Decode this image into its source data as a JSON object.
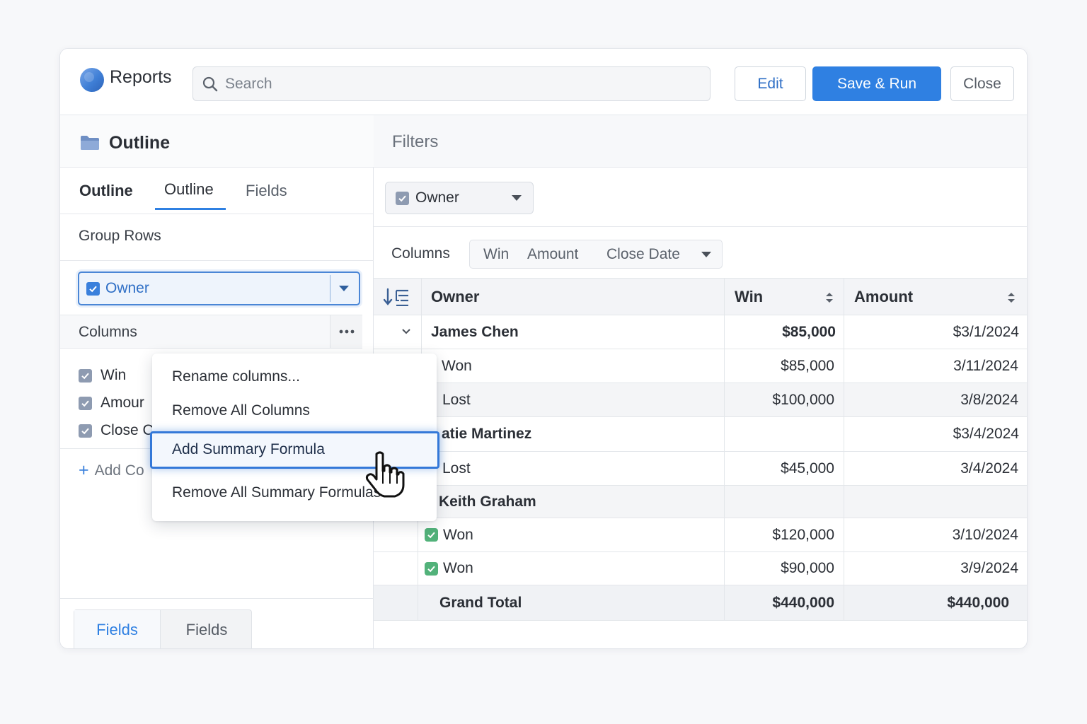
{
  "header": {
    "app_title": "Reports",
    "search_placeholder": "Search",
    "edit_label": "Edit",
    "save_run_label": "Save & Run",
    "close_label": "Close",
    "accent_color": "#2f80e2"
  },
  "left_panel": {
    "title": "Outline",
    "tabs": [
      "Outline",
      "Outline",
      "Fields"
    ],
    "active_tab": 1,
    "group_rows_label": "Group Rows",
    "group_select_value": "Owner",
    "columns_label": "Columns",
    "columns": [
      "Win",
      "Amour",
      "Close C"
    ],
    "add_column_label": "Add Co",
    "bottom_tabs": [
      "Fields",
      "Fields"
    ]
  },
  "menu": {
    "items": [
      "Rename columns...",
      "Remove All Columns",
      "Add Summary Formula",
      "Remove All Summary Formulas"
    ],
    "highlighted_index": 2
  },
  "right_panel": {
    "filters_title": "Filters",
    "filter_value": "Owner",
    "columns_label": "Columns",
    "columns_chips": [
      "Win",
      "Amount",
      "Close Date"
    ],
    "table": {
      "headers": [
        "Owner",
        "Win",
        "Amount"
      ],
      "rows": [
        {
          "type": "group",
          "owner": "James Chen",
          "win": "$85,000",
          "amount": "$3/1/2024"
        },
        {
          "type": "detail",
          "owner": "Won",
          "win": "$85,000",
          "amount": "3/11/2024"
        },
        {
          "type": "detail",
          "owner": "Lost",
          "win": "$100,000",
          "amount": "3/8/2024"
        },
        {
          "type": "group",
          "owner": "atie Martinez",
          "win": "",
          "amount": "$3/4/2024"
        },
        {
          "type": "detail",
          "owner": "Lost",
          "win": "$45,000",
          "amount": "3/4/2024"
        },
        {
          "type": "group",
          "owner": "Keith Graham",
          "win": "",
          "amount": ""
        },
        {
          "type": "detail",
          "owner": "Won",
          "win": "$120,000",
          "amount": "3/10/2024"
        },
        {
          "type": "detail",
          "owner": "Won",
          "win": "$90,000",
          "amount": "3/9/2024"
        }
      ],
      "total": {
        "label": "Grand Total",
        "win": "$440,000",
        "amount": "$440,000"
      }
    }
  }
}
